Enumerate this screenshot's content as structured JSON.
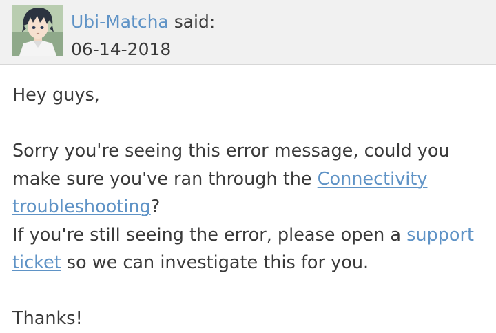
{
  "post": {
    "author": "Ubi-Matcha",
    "said": "said:",
    "date": "06-14-2018",
    "greeting": "Hey guys,",
    "p1_before": "Sorry you're seeing this error message, could you make sure you've ran through the ",
    "link_connectivity": "Connectivity troubleshooting",
    "p1_after": "?",
    "p2_before": "If you're still seeing the error, please open a ",
    "link_support": "support ticket",
    "p2_after": " so we can investigate this for you.",
    "closing": "Thanks!"
  },
  "colors": {
    "link": "#5f93c6",
    "text": "#3a3a3a",
    "header_bg": "#f1f1f1"
  }
}
